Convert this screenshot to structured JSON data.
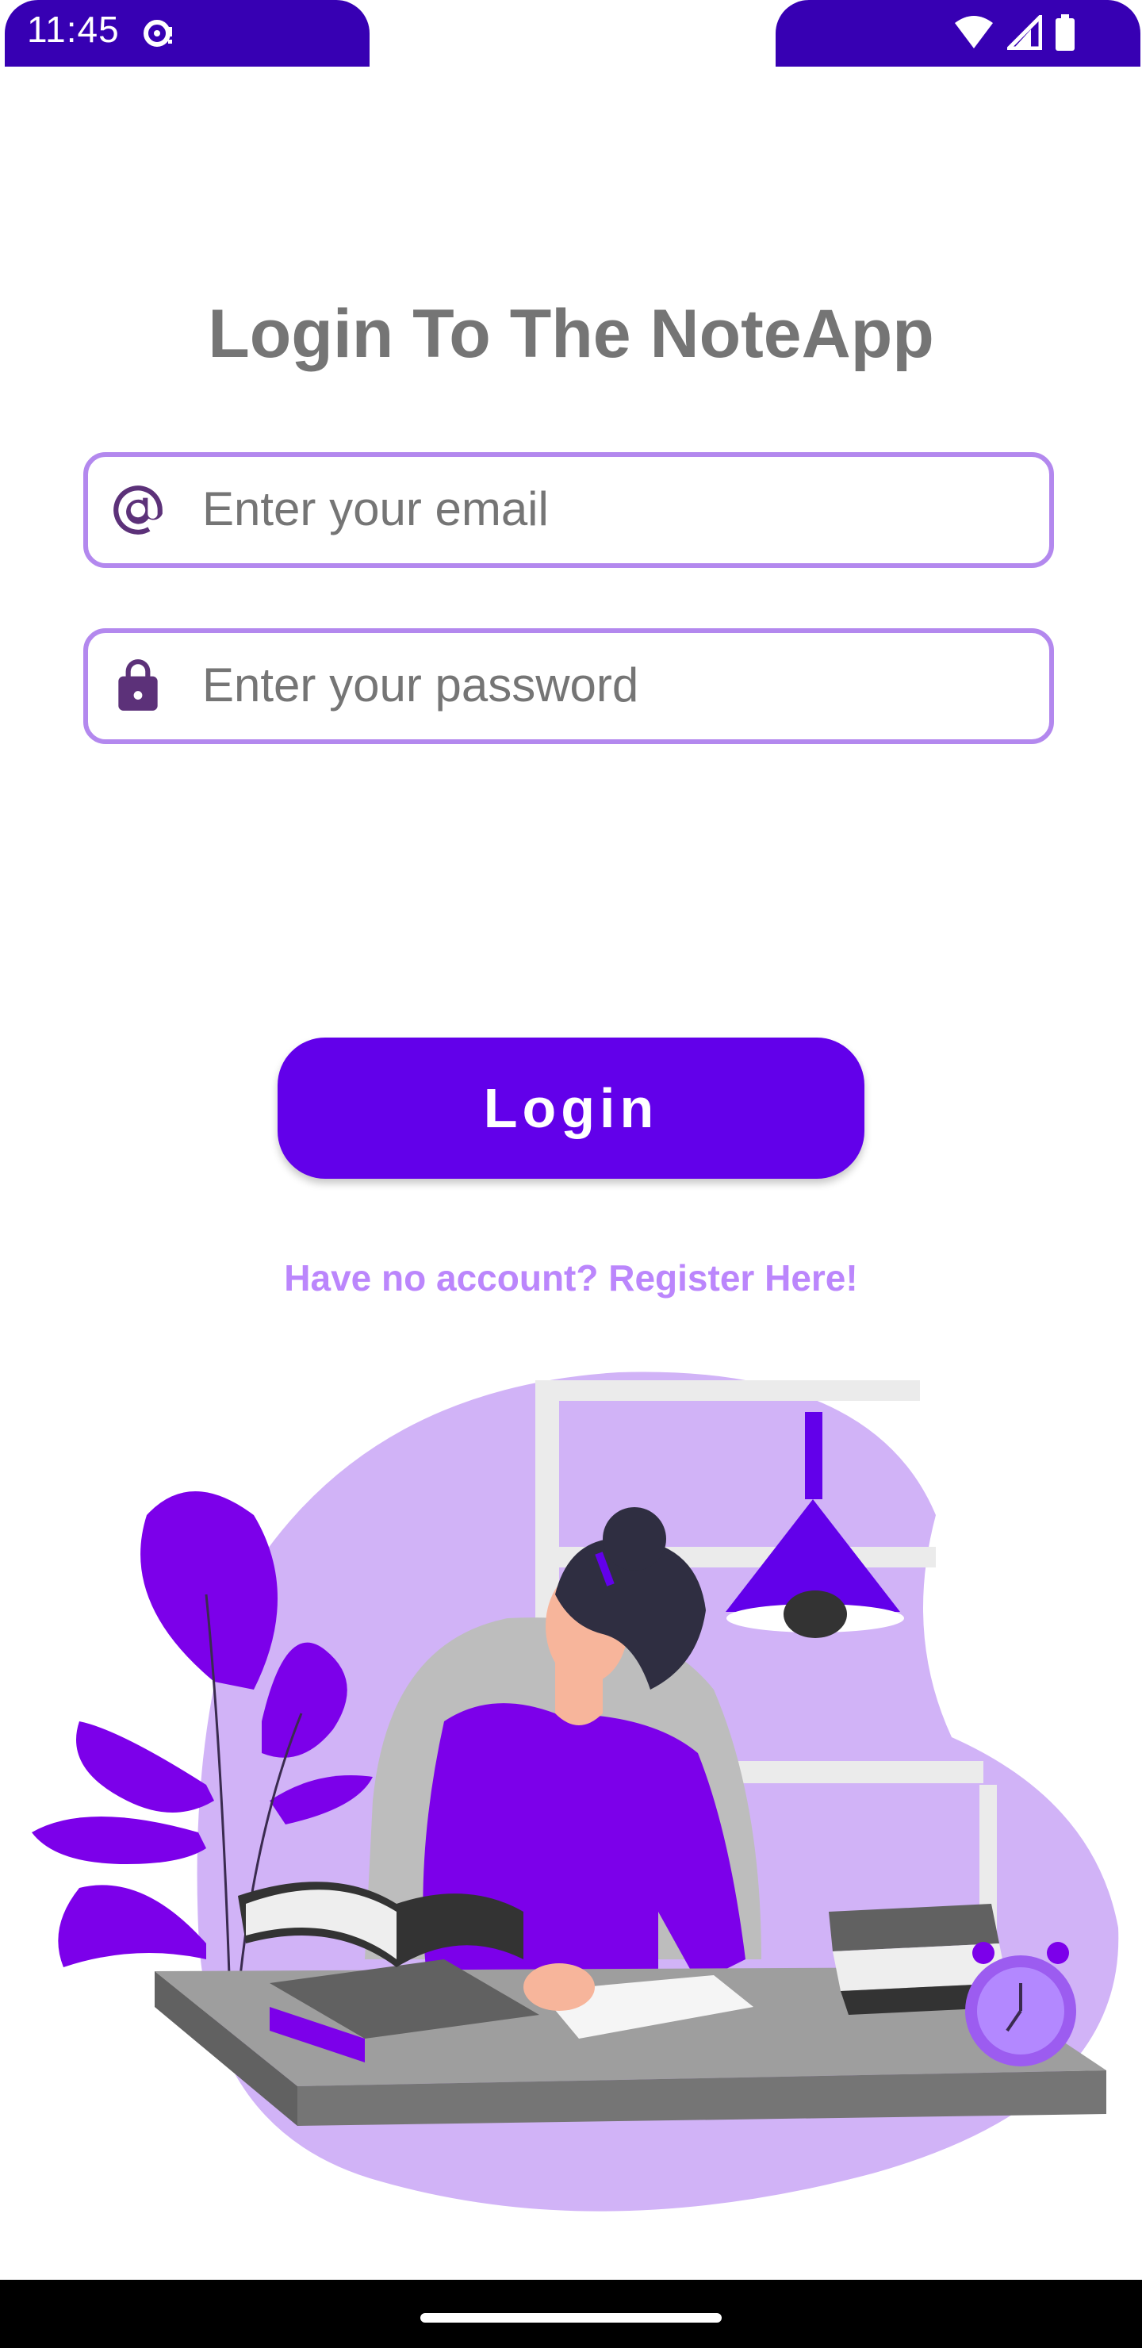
{
  "status_bar": {
    "time": "11:45",
    "bar_color": "#3700b3",
    "left_icons": [
      "sync-icon"
    ],
    "right_icons": [
      "wifi-icon",
      "cell-signal-icon",
      "battery-icon"
    ]
  },
  "login": {
    "title": "Login To The NoteApp",
    "email_placeholder": "Enter your email",
    "email_value": "",
    "password_placeholder": "Enter your password",
    "password_value": "",
    "email_icon": "at-sign-icon",
    "password_icon": "lock-icon",
    "login_button_label": "Login",
    "register_link": "Have no account? Register Here!"
  },
  "colors": {
    "accent": "#6200ea",
    "field_border": "#b388ee",
    "link": "#bb86fc",
    "title": "#757575"
  },
  "illustration": {
    "subject": "woman-studying-at-desk-illustration"
  }
}
